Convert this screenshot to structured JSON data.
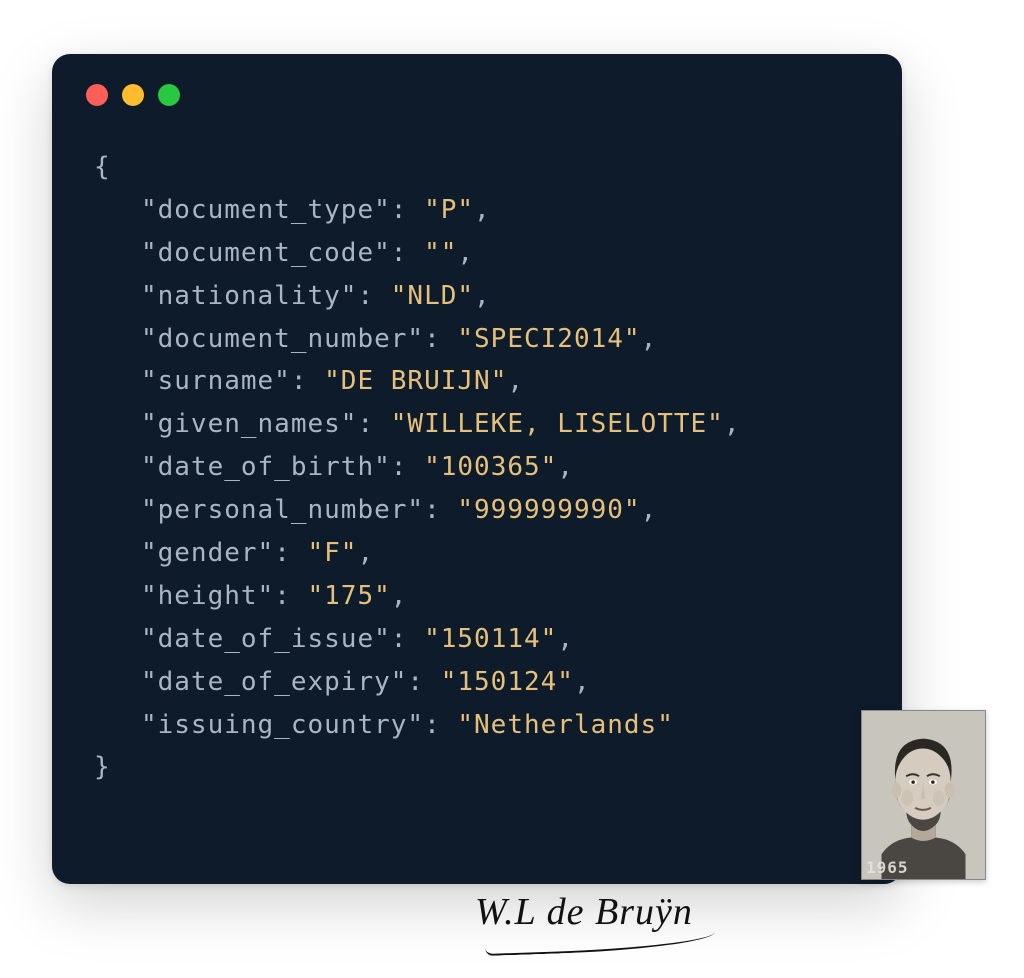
{
  "json_display": {
    "open_brace": "{",
    "close_brace": "}",
    "comma": ",",
    "colon": ": ",
    "entries": [
      {
        "key": "\"document_type\"",
        "value": "\"P\""
      },
      {
        "key": "\"document_code\"",
        "value": "\"\""
      },
      {
        "key": "\"nationality\"",
        "value": "\"NLD\""
      },
      {
        "key": "\"document_number\"",
        "value": "\"SPECI2014\""
      },
      {
        "key": "\"surname\"",
        "value": "\"DE BRUIJN\""
      },
      {
        "key": "\"given_names\"",
        "value": "\"WILLEKE, LISELOTTE\""
      },
      {
        "key": "\"date_of_birth\"",
        "value": "\"100365\""
      },
      {
        "key": "\"personal_number\"",
        "value": "\"999999990\""
      },
      {
        "key": "\"gender\"",
        "value": "\"F\""
      },
      {
        "key": "\"height\"",
        "value": "\"175\""
      },
      {
        "key": "\"date_of_issue\"",
        "value": "\"150114\""
      },
      {
        "key": "\"date_of_expiry\"",
        "value": "\"150124\""
      },
      {
        "key": "\"issuing_country\"",
        "value": "\"Netherlands\""
      }
    ]
  },
  "signature_text": "W.L de Bruÿn",
  "photo_year": "1965"
}
